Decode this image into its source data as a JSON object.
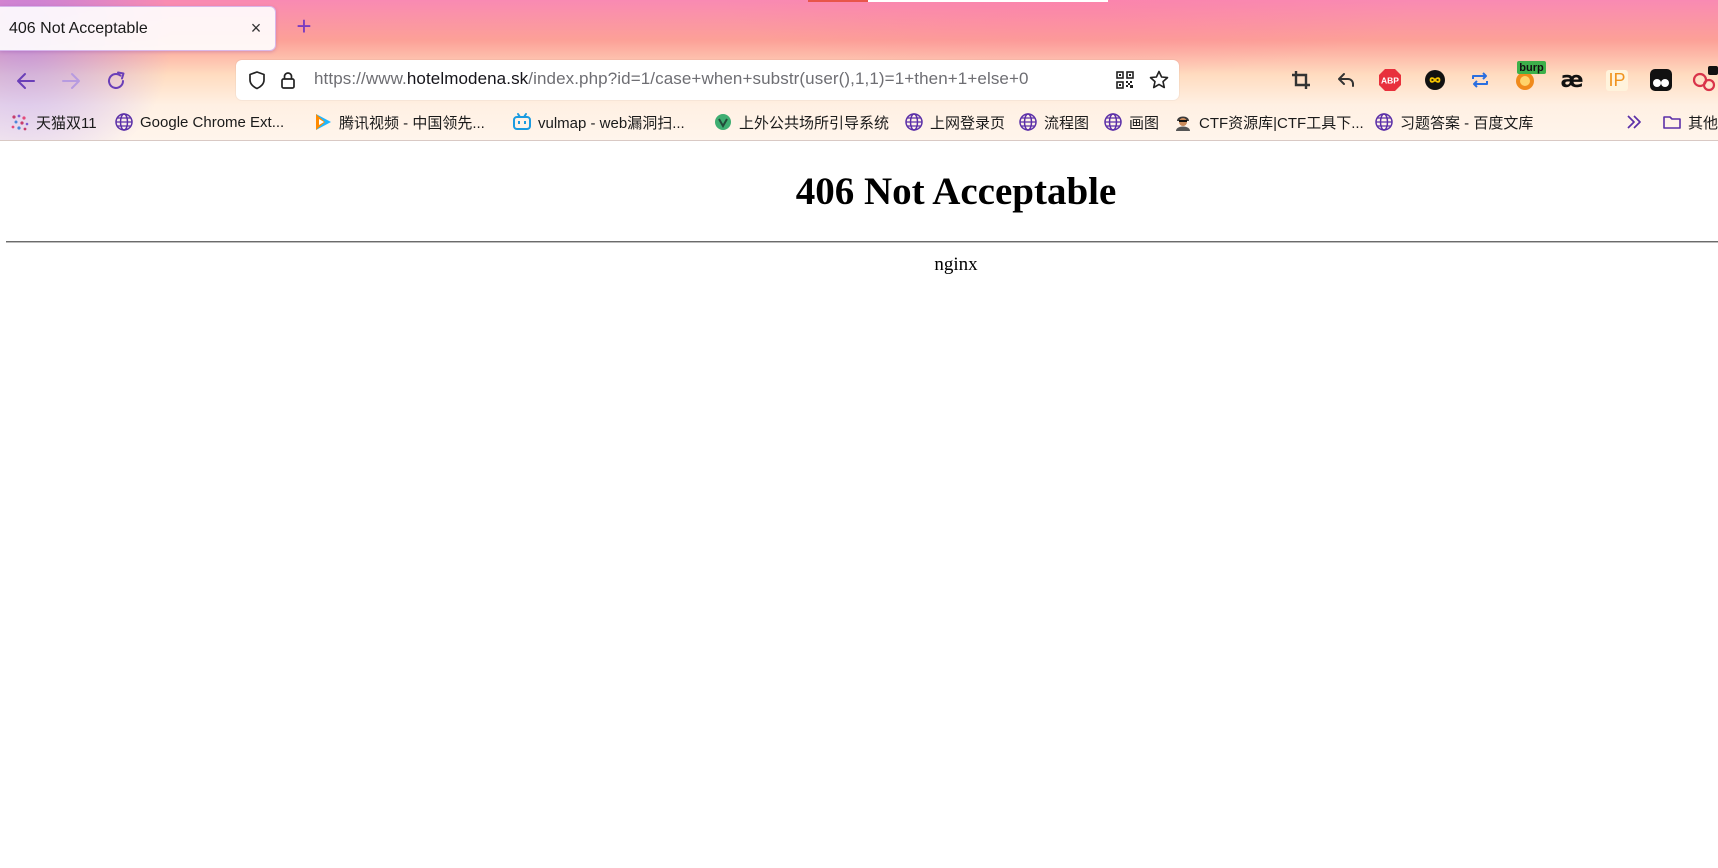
{
  "tab": {
    "title": "406 Not Acceptable",
    "close_glyph": "×",
    "new_tab_glyph": "+"
  },
  "urlbar": {
    "scheme_prefix": "https://www.",
    "host": "hotelmodena.sk",
    "path": "/index.php?id=1/case+when+substr(user(),1,1)=1+then+1+else+0"
  },
  "extensions": {
    "burp_badge": "burp",
    "ae_label": "æ",
    "ip_label": "IP",
    "abp_label": "ABP"
  },
  "bookmarks": [
    {
      "label": "天猫双11",
      "icon": "tmall-icon"
    },
    {
      "label": "Google Chrome Ext...",
      "icon": "globe-icon"
    },
    {
      "label": "腾讯视频 - 中国领先...",
      "icon": "tencent-video-icon"
    },
    {
      "label": "vulmap - web漏洞扫...",
      "icon": "bilibili-icon"
    },
    {
      "label": "上外公共场所引导系统",
      "icon": "vue-icon"
    },
    {
      "label": "上网登录页",
      "icon": "globe-icon"
    },
    {
      "label": "流程图",
      "icon": "globe-icon"
    },
    {
      "label": "画图",
      "icon": "globe-icon"
    },
    {
      "label": "CTF资源库|CTF工具下...",
      "icon": "hacker-icon"
    },
    {
      "label": "习题答案 - 百度文库",
      "icon": "globe-icon"
    }
  ],
  "other_bookmarks": "其他书",
  "page": {
    "heading": "406 Not Acceptable",
    "server": "nginx"
  },
  "colors": {
    "accent_purple": "#7a3cc0",
    "tab_bg": "#fdfafc",
    "page_bg": "#ffffff"
  }
}
